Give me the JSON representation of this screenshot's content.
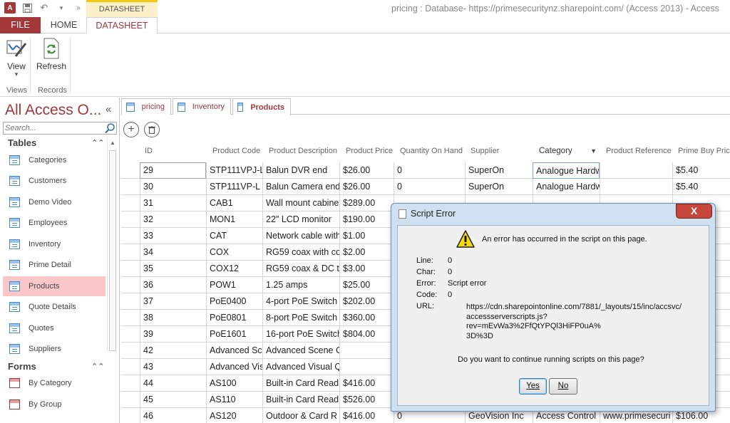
{
  "title_bar": {
    "app_icon_text": "A",
    "context_tool_group": "DATASHEET TOOLS",
    "window_title": "pricing : Database- https://primesecuritynz.sharepoint.com/ (Access 2013) - Access"
  },
  "ribbon": {
    "tabs": [
      "FILE",
      "HOME",
      "DATASHEET"
    ],
    "view_label": "View",
    "refresh_label": "Refresh",
    "group_views": "Views",
    "group_records": "Records"
  },
  "nav": {
    "title": "All Access O...",
    "search_placeholder": "Search...",
    "tables_header": "Tables",
    "forms_header": "Forms",
    "tables": [
      "Categories",
      "Customers",
      "Demo Video",
      "Employees",
      "Inventory",
      "Prime Detail",
      "Products",
      "Quote Details",
      "Quotes",
      "Suppliers"
    ],
    "forms": [
      "By Category",
      "By Group"
    ],
    "selected": "Products"
  },
  "doc_tabs": [
    "pricing",
    "Inventory",
    "Products"
  ],
  "datasheet": {
    "columns": [
      "ID",
      "Product Code",
      "Product Description",
      "Product Price",
      "Quantity On Hand",
      "Supplier",
      "Category",
      "Product Reference",
      "Prime Buy Price"
    ],
    "rows": [
      [
        "29",
        "STP111VPJ-L",
        "Balun DVR end",
        "$26.00",
        "0",
        "SuperOn",
        "Analogue Hardw",
        "",
        "$5.40"
      ],
      [
        "30",
        "STP111VP-L",
        "Balun Camera end",
        "$26.00",
        "0",
        "SuperOn",
        "Analogue Hardw",
        "",
        "$5.40"
      ],
      [
        "31",
        "CAB1",
        "Wall mount cabine",
        "$289.00",
        "",
        "",
        "",
        "",
        ""
      ],
      [
        "32",
        "MON1",
        "22\" LCD monitor",
        "$190.00",
        "",
        "",
        "",
        "",
        ""
      ],
      [
        "33",
        "CAT",
        "Network cable with",
        "$1.00",
        "",
        "",
        "",
        "",
        ""
      ],
      [
        "34",
        "COX",
        "RG59 coax with co",
        "$2.00",
        "",
        "",
        "",
        "",
        ""
      ],
      [
        "35",
        "COX12",
        "RG59 coax & DC tw",
        "$3.00",
        "",
        "",
        "",
        "",
        ""
      ],
      [
        "36",
        "POW1",
        "1.25 amps",
        "$25.00",
        "",
        "",
        "",
        "",
        ""
      ],
      [
        "37",
        "PoE0400",
        "4-port PoE Switch",
        "$202.00",
        "",
        "",
        "",
        "",
        ""
      ],
      [
        "38",
        "PoE0801",
        "8-port PoE Switch",
        "$360.00",
        "",
        "",
        "",
        "",
        ""
      ],
      [
        "39",
        "PoE1601",
        "16-port PoE Switch",
        "$804.00",
        "",
        "",
        "",
        "",
        ""
      ],
      [
        "42",
        "Advanced Sce",
        "Advanced Scene C",
        "",
        "",
        "",
        "",
        "",
        ""
      ],
      [
        "43",
        "Advanced Vis",
        "Advanced Visual Q",
        "",
        "",
        "",
        "",
        "",
        ""
      ],
      [
        "44",
        "AS100",
        "Built-in Card Read",
        "$416.00",
        "",
        "",
        "",
        "",
        ""
      ],
      [
        "45",
        "AS110",
        "Built-in Card Read",
        "$526.00",
        "",
        "",
        "",
        "",
        ""
      ],
      [
        "46",
        "AS120",
        "Outdoor & Card R",
        "$416.00",
        "0",
        "GeoVision Inc",
        "Access Control",
        "www.primesecuri",
        "$106.00"
      ]
    ]
  },
  "dialog": {
    "title": "Script Error",
    "close": "X",
    "message": "An error has occurred in the script on this page.",
    "line_label": "Line:",
    "line_value": "0",
    "char_label": "Char:",
    "char_value": "0",
    "error_label": "Error:",
    "error_value": "Script error",
    "code_label": "Code:",
    "code_value": "0",
    "url_label": "URL:",
    "url_lines": [
      "https://cdn.sharepointonline.com/7881/_layouts/15/inc/accsvc/",
      "accessserverscripts.js?rev=mEvWa3%2FfQtYPQl3HiFP0uA%",
      "3D%3D"
    ],
    "question": "Do you want to continue running scripts on this page?",
    "yes_label": "Yes",
    "no_label": "No"
  },
  "colors": {
    "access_red": "#a4373a",
    "selected_nav": "#f9c7c7",
    "dialog_frame": "#cfe0f1",
    "close_red": "#c7463b"
  }
}
